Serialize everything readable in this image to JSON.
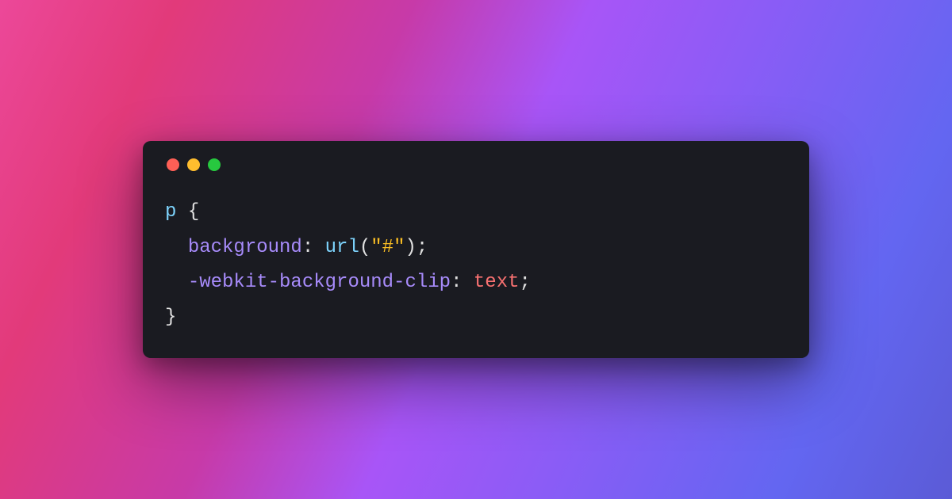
{
  "window": {
    "controls": {
      "close_color": "#ff5f56",
      "minimize_color": "#ffbd2e",
      "maximize_color": "#27c93f"
    }
  },
  "code": {
    "selector": "p",
    "brace_open": "{",
    "indent": "  ",
    "line1": {
      "property": "background",
      "colon": ":",
      "space": " ",
      "func": "url",
      "paren_open": "(",
      "string": "\"#\"",
      "paren_close": ")",
      "semi": ";"
    },
    "line2": {
      "property": "-webkit-background-clip",
      "colon": ":",
      "space": " ",
      "value": "text",
      "semi": ";"
    },
    "brace_close": "}"
  },
  "colors": {
    "bg_gradient_start": "#ec4899",
    "bg_gradient_end": "#6366f1",
    "window_bg": "#1a1b21",
    "selector": "#7dd3fc",
    "property": "#a78bfa",
    "func": "#7dd3fc",
    "string": "#fbbf24",
    "value": "#f87171",
    "default_text": "#e0e0e0"
  }
}
